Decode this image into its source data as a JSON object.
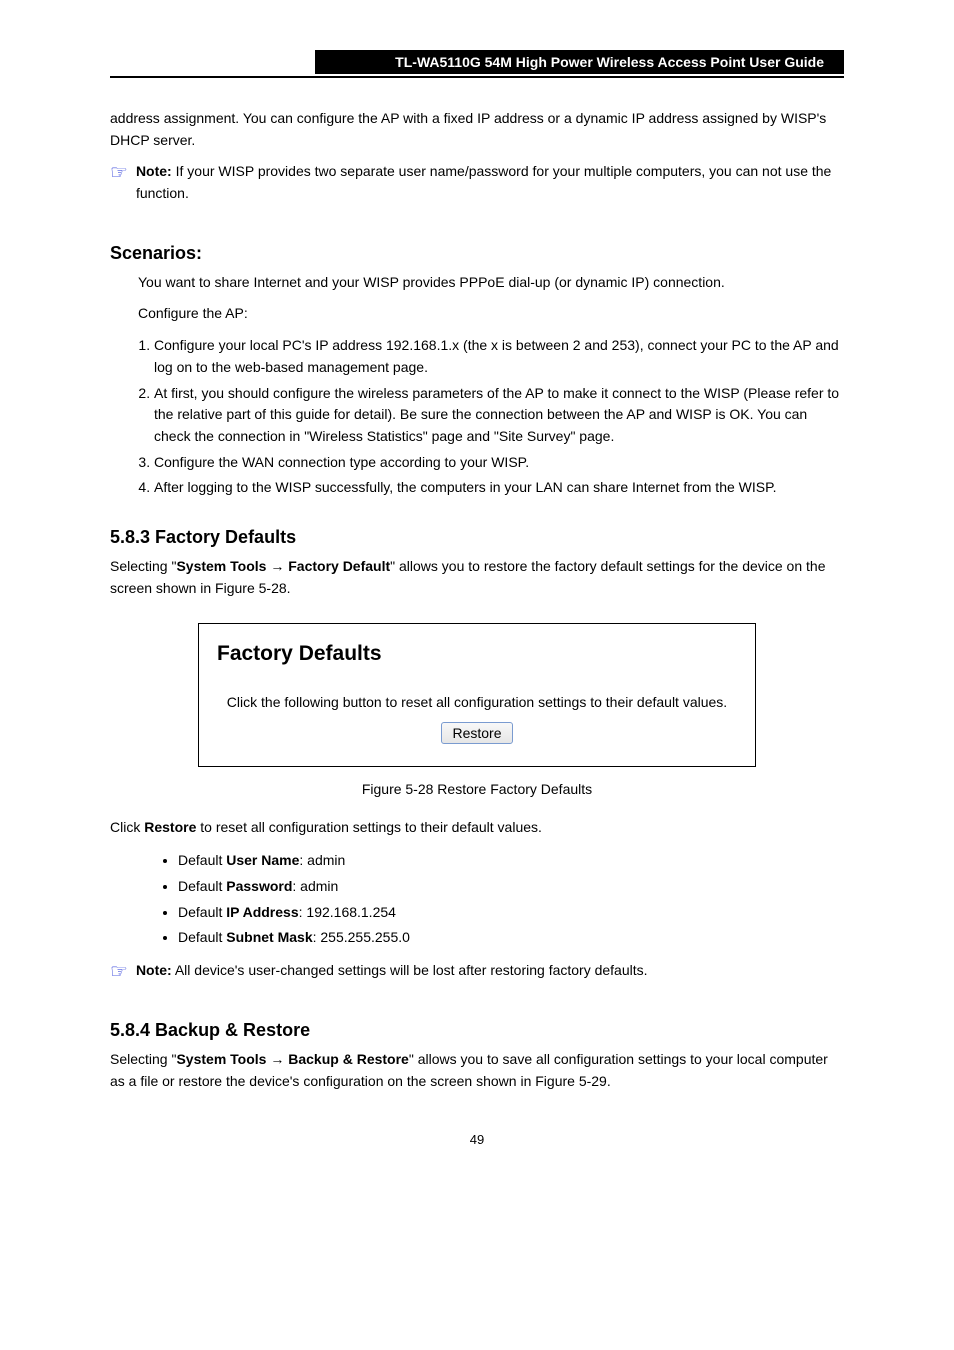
{
  "header": {
    "title": "TL-WA5110G   54M High Power Wireless Access Point User Guide"
  },
  "intro1": "address assignment. You can configure the AP with a fixed IP address or a dynamic IP address assigned by WISP's DHCP server.",
  "note1": {
    "label": "Note:",
    "text": "If your WISP provides two separate user name/password for your multiple computers, you can not use the function."
  },
  "section_scenario": {
    "heading": "Scenarios:",
    "desc": "You want to share Internet and your WISP provides PPPoE dial-up (or dynamic IP) connection.",
    "configure": "Configure the AP:",
    "steps": [
      "Configure your local PC's IP address 192.168.1.x (the x is between 2 and 253), connect your PC to the AP and log on to the web-based management page.",
      "At first, you should configure the wireless parameters of the AP to make it connect to the WISP (Please refer to the relative part of this guide for detail). Be sure the connection between the AP and WISP is OK. You can check the connection in \"Wireless Statistics\" page and \"Site Survey\" page.",
      "Configure the WAN connection type according to your WISP.",
      "After logging to the WISP successfully, the computers in your LAN can share Internet from the WISP."
    ]
  },
  "section_factory": {
    "heading": "5.8.3   Factory Defaults",
    "intro": "Selecting System Tools > Factory Default allows you to restore the factory default settings for the device on the screen shown in Figure 5-28.",
    "menu_left": "System Tools",
    "menu_right": "Factory Default",
    "figure": {
      "title": "Factory Defaults",
      "text": "Click the following button to reset all configuration settings to their default values.",
      "button": "Restore",
      "caption": "Figure 5-28  Restore Factory Defaults"
    },
    "after_intro": "Click Restore to reset all configuration settings to their default values.",
    "bullets": [
      "Default User Name: admin",
      "Default Password: admin",
      "Default IP Address: 192.168.1.254",
      "Default Subnet Mask: 255.255.255.0"
    ]
  },
  "note2": {
    "label": "Note:",
    "text": "All device's user-changed settings will be lost after restoring factory defaults."
  },
  "section_backup": {
    "heading": "5.8.4   Backup & Restore",
    "intro_prefix": "Selecting ",
    "menu_left": "System Tools",
    "menu_right": "Backup & Restore",
    "intro_suffix": " allows you to save all configuration settings to your local computer as a file or restore the device's configuration on the screen shown in Figure 5-29."
  },
  "footer": "49"
}
